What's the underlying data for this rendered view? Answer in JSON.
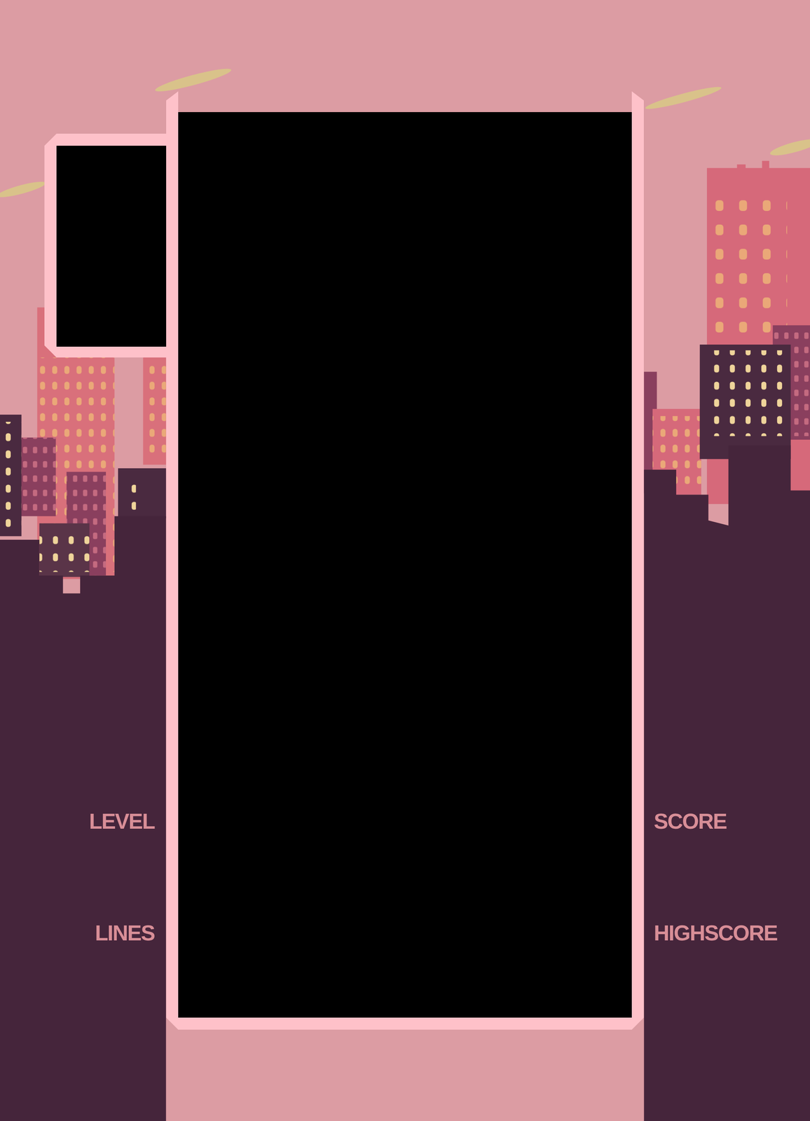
{
  "stats_left": [
    {
      "label": "LEVEL"
    },
    {
      "label": "LINES"
    }
  ],
  "stats_right": [
    {
      "label": "SCORE"
    },
    {
      "label": "HIGHSCORE"
    }
  ]
}
